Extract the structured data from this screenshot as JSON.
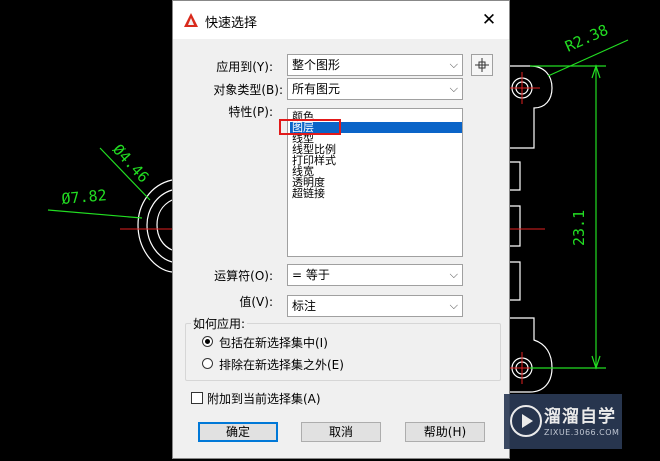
{
  "dialog": {
    "title": "快速选择",
    "close_symbol": "✕",
    "apply_to": {
      "label": "应用到(Y):",
      "value": "整个图形"
    },
    "object_type": {
      "label": "对象类型(B):",
      "value": "所有图元"
    },
    "properties": {
      "label": "特性(P):",
      "items": [
        "颜色",
        "图层",
        "线型",
        "线型比例",
        "打印样式",
        "线宽",
        "透明度",
        "超链接"
      ],
      "selected": "图层"
    },
    "operator": {
      "label": "运算符(O):",
      "value": "= 等于"
    },
    "value": {
      "label": "值(V):",
      "value": "标注"
    },
    "how_to_apply": {
      "label": "如何应用:",
      "include": "包括在新选择集中(I)",
      "exclude": "排除在新选择集之外(E)"
    },
    "append_label": "附加到当前选择集(A)",
    "buttons": {
      "ok": "确定",
      "cancel": "取消",
      "help": "帮助(H)"
    }
  },
  "drawing": {
    "dim_radius": "R2.38",
    "dim_diameter_small": "Ø4.46",
    "dim_diameter_large": "Ø7.82",
    "dim_length": "23.1",
    "line_color": "#ffffff",
    "dim_color": "#22dd22",
    "center_color": "#e02020"
  },
  "watermark": {
    "text": "溜溜自学",
    "sub": "ZIXUE.3066.COM"
  },
  "colors": {
    "selection": "#0a64c8",
    "highlight_box": "#e21a1a",
    "default_button": "#0078d7"
  }
}
